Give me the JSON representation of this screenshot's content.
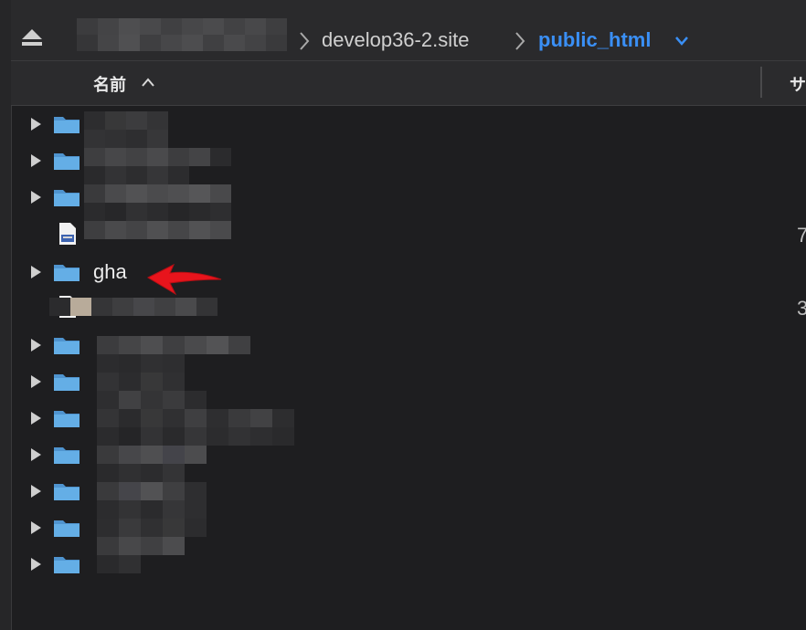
{
  "breadcrumb": {
    "site": "develop36-2.site",
    "current": "public_html"
  },
  "columns": {
    "name": "名前",
    "size": "サ"
  },
  "rows": [
    {
      "type": "folder",
      "name": "",
      "size": ""
    },
    {
      "type": "folder",
      "name": "",
      "size": ""
    },
    {
      "type": "folder",
      "name": "",
      "size": ""
    },
    {
      "type": "file",
      "name": "",
      "size": "7"
    },
    {
      "type": "folder",
      "name": "gha",
      "size": ""
    },
    {
      "type": "file",
      "name": "",
      "size": "3"
    },
    {
      "type": "folder",
      "name": "",
      "size": ""
    },
    {
      "type": "folder",
      "name": "",
      "size": ""
    },
    {
      "type": "folder",
      "name": "",
      "size": ""
    },
    {
      "type": "folder",
      "name": "",
      "size": ""
    },
    {
      "type": "folder",
      "name": "",
      "size": ""
    },
    {
      "type": "folder",
      "name": "",
      "size": ""
    },
    {
      "type": "folder",
      "name": "",
      "size": ""
    }
  ],
  "colors": {
    "accent": "#3a8ff5",
    "folder": "#5aa0d8",
    "annotation_arrow": "#e8141c"
  },
  "icons": [
    "eject-icon",
    "chevron-right-icon",
    "chevron-down-icon",
    "sort-ascending-icon",
    "disclosure-triangle-icon",
    "folder-icon",
    "document-icon",
    "red-arrow-annotation"
  ]
}
